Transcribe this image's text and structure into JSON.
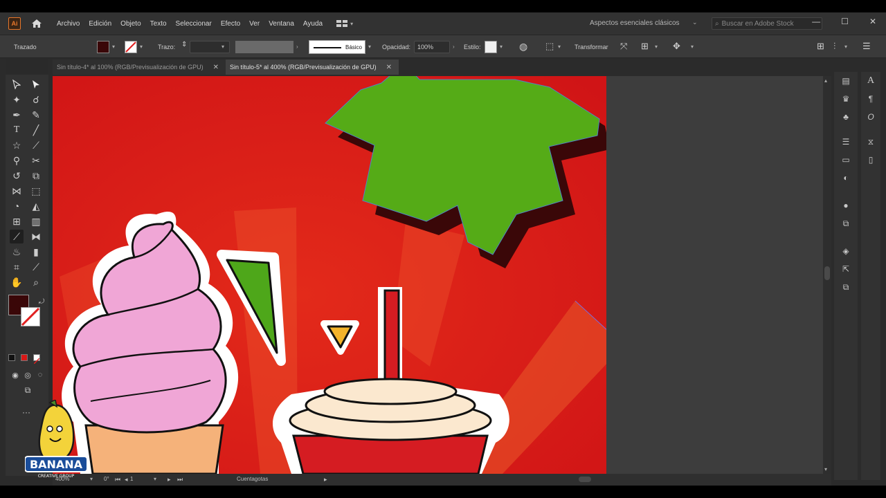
{
  "menu": {
    "items": [
      "Archivo",
      "Edición",
      "Objeto",
      "Texto",
      "Seleccionar",
      "Efecto",
      "Ver",
      "Ventana",
      "Ayuda"
    ],
    "workspace": "Aspectos esenciales clásicos",
    "search_placeholder": "Buscar en Adobe Stock",
    "app_icon": "Ai"
  },
  "control": {
    "selection_label": "Trazado",
    "stroke_label": "Trazo:",
    "stroke_profile": "Básico",
    "opacity_label": "Opacidad:",
    "opacity_value": "100%",
    "style_label": "Estilo:",
    "transform_label": "Transformar",
    "fill_color": "#3a0708"
  },
  "tabs": [
    {
      "label": "Sin título-4* al 100% (RGB/Previsualización de GPU)",
      "active": false,
      "close": "✕"
    },
    {
      "label": "Sin título-5* al 400% (RGB/Previsualización de GPU)",
      "active": true,
      "close": "✕"
    }
  ],
  "status": {
    "zoom": "400%",
    "rotation": "0°",
    "artboard": "1",
    "tool_name": "Cuentagotas"
  },
  "brand": {
    "name": "BANANA",
    "tagline": "CREATIVE GROUP"
  },
  "colors": {
    "artboard_bg": "#d81817",
    "star_green": "#55ab17",
    "cream_pink": "#f0a6d6",
    "cup_red": "#d51c22",
    "accent_orange": "#e7762a"
  }
}
